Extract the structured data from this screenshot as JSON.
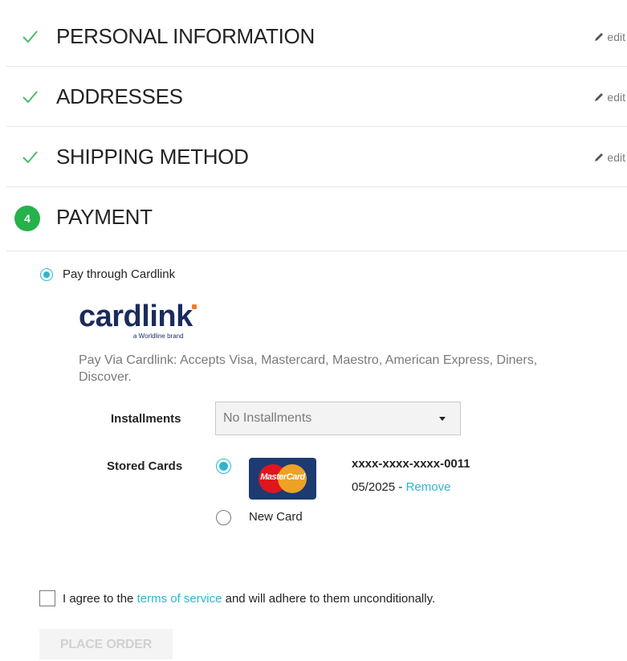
{
  "steps": [
    {
      "title": "PERSONAL INFORMATION",
      "edit": "edit"
    },
    {
      "title": "ADDRESSES",
      "edit": "edit"
    },
    {
      "title": "SHIPPING METHOD",
      "edit": "edit"
    }
  ],
  "current_step": {
    "number": "4",
    "title": "PAYMENT"
  },
  "payment": {
    "option_label": "Pay through Cardlink",
    "brand": {
      "name": "cardlink",
      "tagline": "a Worldline brand"
    },
    "description_line1": "Pay Via Cardlink: Accepts Visa, Mastercard, Maestro, American Express, Diners,",
    "description_line2": "Discover.",
    "installments_label": "Installments",
    "installments_value": "No Installments",
    "stored_cards_label": "Stored Cards",
    "stored_card": {
      "brand_logo": "MasterCard",
      "number": "xxxx-xxxx-xxxx-0011",
      "expiry": "05/2025",
      "separator": " - ",
      "remove": "Remove"
    },
    "new_card_label": "New Card"
  },
  "terms": {
    "before": "I agree to the ",
    "link": "terms of service",
    "after": " and will adhere to them unconditionally."
  },
  "place_order": "PLACE ORDER",
  "colors": {
    "accent": "#2fb5d2",
    "success": "#24b24a"
  },
  "icons": {
    "done": "check-icon",
    "edit": "pencil-icon"
  }
}
